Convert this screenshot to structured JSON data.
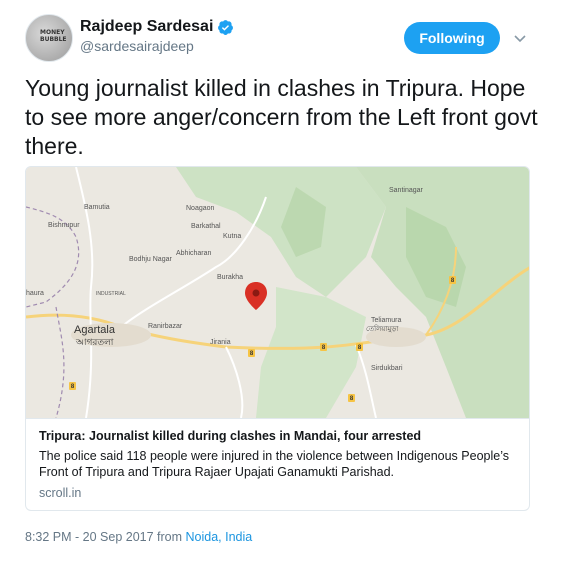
{
  "user": {
    "name": "Rajdeep Sardesai",
    "handle": "@sardesairajdeep",
    "avatar_text": "MONEY BUBBLE"
  },
  "actions": {
    "follow_label": "Following"
  },
  "tweet": {
    "text": "Young journalist killed in clashes in Tripura. Hope to see more anger/concern from the Left front govt there."
  },
  "card": {
    "title": "Tripura: Journalist killed during clashes in Mandai, four arrested",
    "description": "The police said 118 people were injured in the violence between Indigenous People’s Front of Tripura and Tripura Rajaer Upajati Ganamukti Parishad.",
    "domain": "scroll.in",
    "map_labels": {
      "agartala": "Agartala",
      "agartala_local": "আগরতলা",
      "santinagar": "Santinagar",
      "bishupur": "Bishnupur",
      "kamalpur": "Bamutia",
      "noagaon": "Noagaon",
      "barkathal": "Barkathal",
      "kutna": "Kutna",
      "bodhjungnagar": "Bodhju Nagar",
      "abhicharan": "Abhicharan",
      "burakha": "Burakha",
      "ranirbazar": "Ranirbazar",
      "jirania": "Jirania",
      "teliamura": "Teliamura",
      "teliamura_local": "তেলিয়ামুড়া",
      "sidhai": "Sirdukbari",
      "hawra": "haura",
      "industrial": "INDUSTRIAL"
    },
    "road_markers": [
      "8",
      "8",
      "8",
      "8",
      "8",
      "8"
    ]
  },
  "footer": {
    "time": "8:32 PM - 20 Sep 2017 from ",
    "location": "Noida, India"
  },
  "colors": {
    "accent": "#1da1f2",
    "link": "#1b95e0",
    "pin": "#d93025"
  }
}
